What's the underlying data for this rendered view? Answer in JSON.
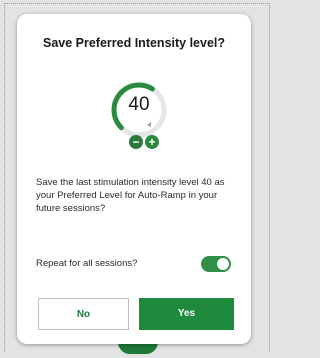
{
  "dialog": {
    "title": "Save Preferred Intensity level?",
    "intensity_value": "40",
    "gauge_level_fraction": 0.4,
    "description": "Save the last stimulation intensity level 40 as your Preferred Level for Auto-Ramp in your future sessions?",
    "repeat_label": "Repeat for all sessions?",
    "repeat_enabled": true,
    "no_label": "No",
    "yes_label": "Yes",
    "icons": {
      "minus": "minus-icon",
      "plus": "plus-icon"
    },
    "colors": {
      "accent": "#2a8a3f",
      "primary_button": "#1f8a3c",
      "track": "#e0e0e0"
    }
  }
}
